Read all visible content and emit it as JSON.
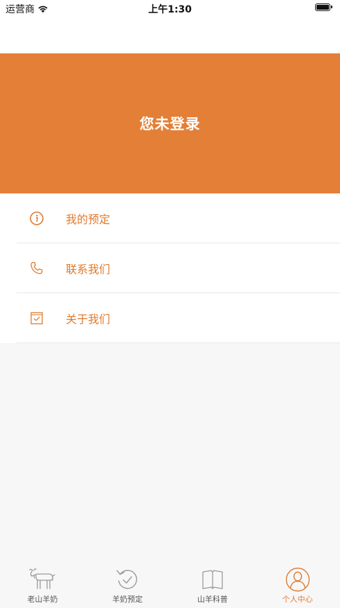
{
  "status_bar": {
    "carrier": "运营商",
    "time": "上午1:30"
  },
  "header": {
    "login_status": "您未登录",
    "background_color": "#e37f37"
  },
  "menu": {
    "items": [
      {
        "label": "我的预定",
        "icon": "info-icon"
      },
      {
        "label": "联系我们",
        "icon": "phone-icon"
      },
      {
        "label": "关于我们",
        "icon": "checkbox-icon"
      }
    ]
  },
  "tab_bar": {
    "tabs": [
      {
        "label": "老山羊奶",
        "icon": "goat-icon",
        "active": false
      },
      {
        "label": "羊奶预定",
        "icon": "refresh-check-icon",
        "active": false
      },
      {
        "label": "山羊科普",
        "icon": "book-icon",
        "active": false
      },
      {
        "label": "个人中心",
        "icon": "user-profile-icon",
        "active": true
      }
    ]
  },
  "colors": {
    "accent": "#e07a2e",
    "inactive": "#555555",
    "background": "#f7f7f7"
  }
}
